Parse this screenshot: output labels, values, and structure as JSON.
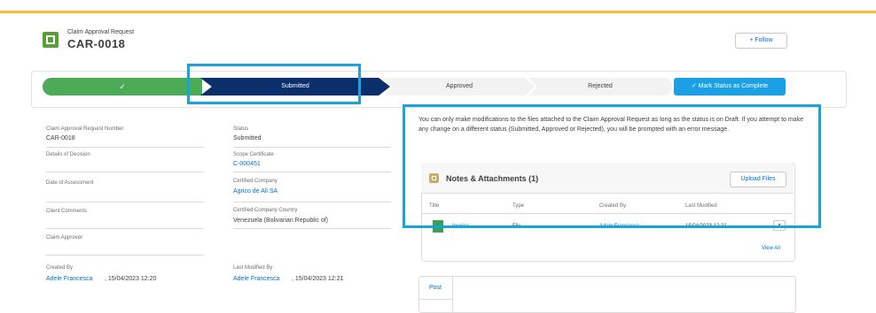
{
  "header": {
    "object_type": "Claim Approval Request",
    "record_name": "CAR-0018",
    "follow_label": "+ Follow"
  },
  "path": {
    "steps": [
      "✓",
      "Submitted",
      "Approved",
      "Rejected"
    ],
    "current_step": "Submitted",
    "mark_button": "✓ Mark Status as Complete"
  },
  "fields": {
    "name_label": "Claim Approval Request Number",
    "name_value": "CAR-0018",
    "status_label": "Status",
    "status_value": "Submitted",
    "details_label": "Details of Decision",
    "scope_label": "Scope Certificate",
    "scope_value": "C-000451",
    "date_label": "Date of Assessment",
    "company_label": "Certified Company",
    "company_value": "Agrico de Ali SA",
    "comments_label": "Client Comments",
    "country_label": "Certified Company Country",
    "country_value": "Venezuela (Bolivarian Republic of)",
    "approver_label": "Claim Approver",
    "created_label": "Created By",
    "created_user": "Adele Francesca",
    "created_date": ", 15/04/2023 12:20",
    "modified_label": "Last Modified By",
    "modified_user": "Adele Francesca",
    "modified_date": ", 15/04/2023 12:21"
  },
  "info_text": "You can only make modifications to the files attached to the Claim Approval Request as long as the status is on Draft. If you attempt to make any change on a different status (Submitted, Approved or Rejected), you will be prompted with an error message.",
  "notes": {
    "title": "Notes & Attachments (1)",
    "upload_label": "Upload Files",
    "columns": [
      "Title",
      "Type",
      "Created By",
      "Last Modified"
    ],
    "rows": [
      {
        "title": "Invoice",
        "type": "File",
        "created_by": "Adele Francesca",
        "last_modified": "15/04/2023 12:21"
      }
    ],
    "view_all": "View All",
    "row_menu": "▾"
  },
  "feed": {
    "post_tab": "Post"
  },
  "colors": {
    "accent": "#1aa3d8",
    "path_done": "#4bab57",
    "path_current": "#0a2f6b",
    "top_bar": "#f2c230"
  }
}
